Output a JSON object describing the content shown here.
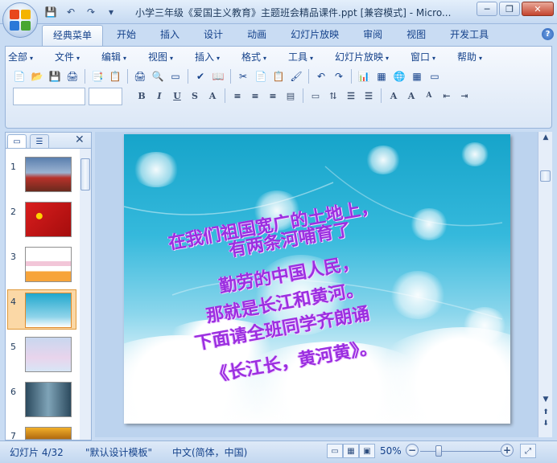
{
  "window": {
    "title": "小学三年级《爱国主义教育》主题班会精品课件.ppt [兼容模式] - Micro...",
    "minimize_icon": "─",
    "restore_icon": "❐",
    "close_icon": "✕"
  },
  "qat": {
    "save_icon": "💾",
    "undo_icon": "↶",
    "redo_icon": "↷",
    "customize_icon": "▾"
  },
  "ribbon_tabs": [
    "经典菜单",
    "开始",
    "插入",
    "设计",
    "动画",
    "幻灯片放映",
    "审阅",
    "视图",
    "开发工具"
  ],
  "help_label": "?",
  "menus": [
    {
      "label": "全部",
      "icon": "▾"
    },
    {
      "label": "文件",
      "icon": "▾"
    },
    {
      "label": "编辑",
      "icon": "▾"
    },
    {
      "label": "视图",
      "icon": "▾"
    },
    {
      "label": "插入",
      "icon": "▾"
    },
    {
      "label": "格式",
      "icon": "▾"
    },
    {
      "label": "工具",
      "icon": "▾"
    },
    {
      "label": "幻灯片放映",
      "icon": "▾"
    },
    {
      "label": "窗口",
      "icon": "▾"
    },
    {
      "label": "帮助",
      "icon": "▾"
    }
  ],
  "toolbar1": [
    "📄",
    "📂",
    "💾",
    "🖨",
    "📑",
    "📋",
    "🖨",
    "🔍",
    "▭",
    "✔",
    "📖",
    "✂",
    "📄",
    "📋",
    "🖌",
    "↶",
    "↷",
    "📊",
    "▦",
    "🌐",
    "▦",
    "▭"
  ],
  "format_buttons": [
    "B",
    "I",
    "U",
    "S",
    "A",
    "≡",
    "≡",
    "≡",
    "▤",
    "▭",
    "⇅",
    "☰",
    "☰",
    "A",
    "A",
    "A",
    "⇤",
    "⇥"
  ],
  "panel": {
    "tab1_icon": "▭",
    "tab2_icon": "☰",
    "close_icon": "✕"
  },
  "slides": [
    {
      "num": "1"
    },
    {
      "num": "2"
    },
    {
      "num": "3"
    },
    {
      "num": "4"
    },
    {
      "num": "5"
    },
    {
      "num": "6"
    },
    {
      "num": "7"
    }
  ],
  "slide_text": {
    "line1": "在我们祖国宽广的土地上，",
    "line2": "有两条河哺育了",
    "line3": "勤劳的中国人民，",
    "line4": "那就是长江和黄河。",
    "line5": "下面请全班同学齐朗诵",
    "line6": "《长江长，黄河黄》。"
  },
  "status": {
    "slide_info": "幻灯片 4/32",
    "template": "\"默认设计模板\"",
    "language": "中文(简体，中国)",
    "zoom": "50%",
    "zoom_out": "−",
    "zoom_in": "+",
    "fit": "⤢"
  },
  "views": [
    "▭",
    "▦",
    "▣"
  ],
  "right_scroll": {
    "up": "▲",
    "down": "▼",
    "prev": "⬆",
    "next": "⬇"
  }
}
